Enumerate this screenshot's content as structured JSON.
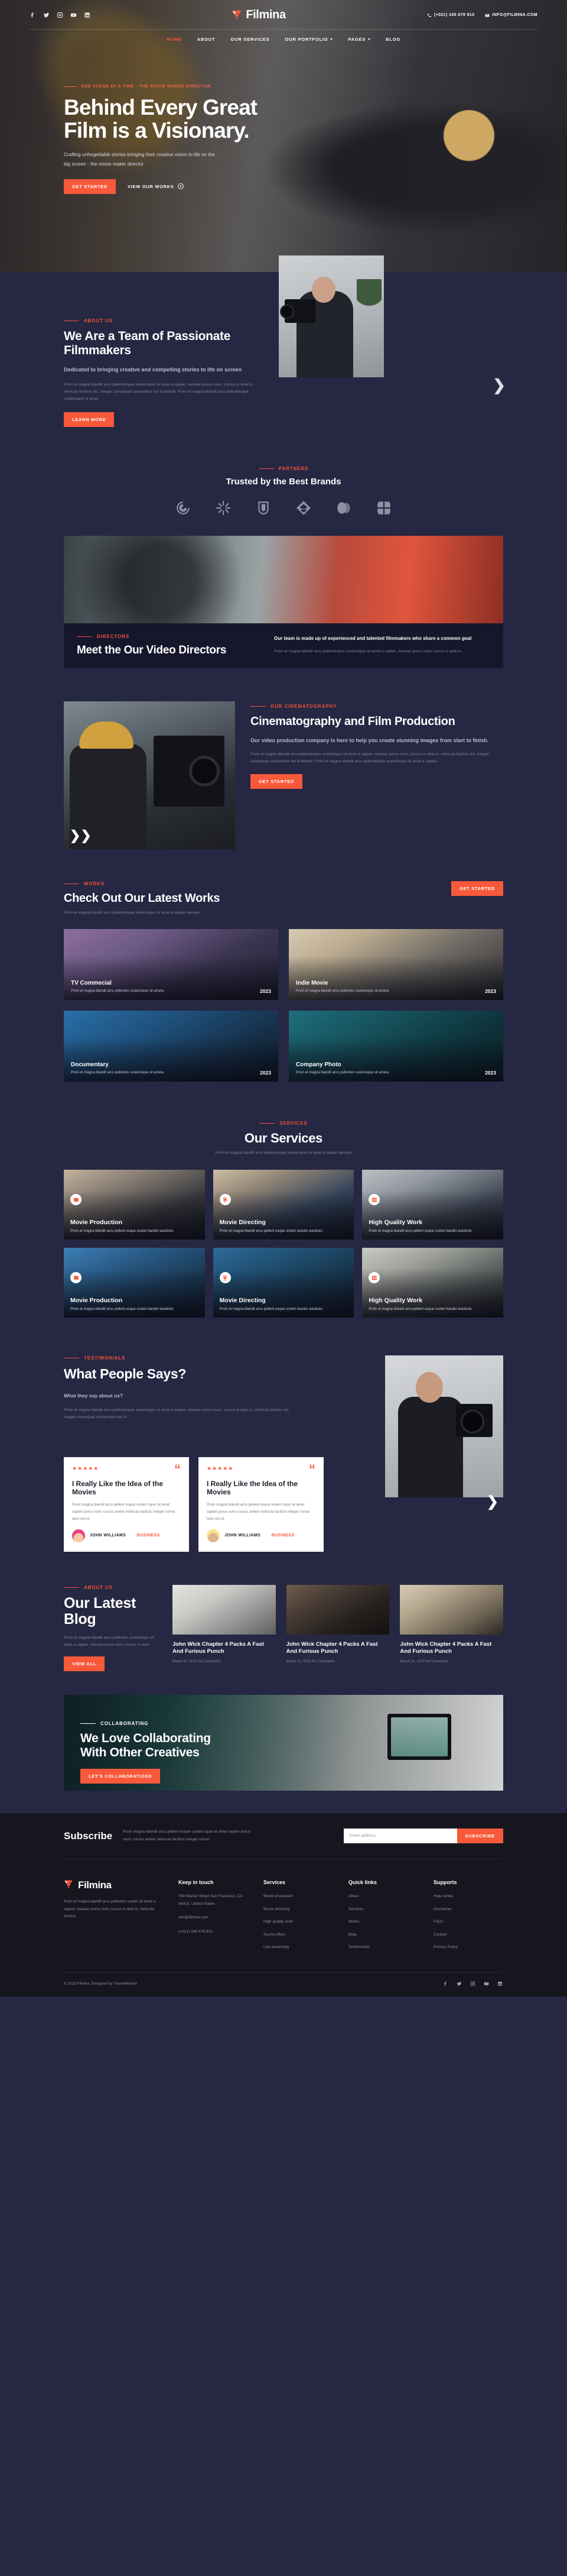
{
  "brand": {
    "name": "Filmina"
  },
  "topbar": {
    "socials": [
      "facebook-icon",
      "twitter-icon",
      "instagram-icon",
      "youtube-icon",
      "linkedin-icon"
    ],
    "phone": "(+021) 345 678 910",
    "email": "INFO@FILMINA.COM"
  },
  "nav": {
    "items": [
      {
        "label": "HOME",
        "active": true,
        "caret": false
      },
      {
        "label": "ABOUT",
        "active": false,
        "caret": false
      },
      {
        "label": "OUR SERVICES",
        "active": false,
        "caret": false
      },
      {
        "label": "OUR PORTFOLIO",
        "active": false,
        "caret": true
      },
      {
        "label": "PAGES",
        "active": false,
        "caret": true
      },
      {
        "label": "BLOG",
        "active": false,
        "caret": false
      }
    ]
  },
  "hero": {
    "eyebrow": "ONE SCENE AT A TIME - THE MOVIE MAKER DIRECTOR.",
    "title_line1": "Behind Every Great",
    "title_line2": "Film is a Visionary.",
    "subtitle": "Crafting unforgettable stories bringing their creative vision to life on the big screen - the movie maker director",
    "primary_cta": "GET STARTED",
    "secondary_cta": "VIEW OUR WORKS"
  },
  "about": {
    "eyebrow": "ABOUT US",
    "title": "We Are a Team of Passionate Filmmakers",
    "lead": "Dedicated to bringing creative and compelling stories to life on screen",
    "body": "Proin et magna blandit arcu pellentesque scelerisque sit amet a sapien. Aenean purus nunc, cursus in ante in, vehicula facilisis dui. Integer consequat consectetur est id blandit. Proin et magna blandit arcu pellentesque scelerisque sit amet.",
    "cta": "LEARN MORE"
  },
  "partners": {
    "eyebrow": "PARTNERS",
    "title": "Trusted by the Best Brands",
    "logos": [
      "loop-logo",
      "burst-logo",
      "arch-logo",
      "chevron-diamond-logo",
      "двойной-oval-logo",
      "quad-logo"
    ]
  },
  "directors": {
    "eyebrow": "DIRECTORS",
    "title": "Meet the Our Video Directors",
    "lead": "Our team is made up of experienced and talented filmmakers who share a common goal",
    "body": "Proin et magna blandit arcu pellentesque scelerisque sit amet a sapien. Aenean purus nunc cursus in ante in."
  },
  "cinematography": {
    "eyebrow": "OUR CINEMATOGRAPHY",
    "title": "Cinematography and Film Production",
    "lead": "Our video production company is here to help you create stunning images from start to finish.",
    "body": "Proin et magna blandit arcu pellentesque scelerisque sit amet a sapien. Aenean purus nunc, cursus in ante in, vehicula facilisis dui. Integer consequat consectetur est id blandit. Proin et magna blandit arcu pellentesque scelerisque sit amet a sapien.",
    "cta": "GET STARTED"
  },
  "works": {
    "eyebrow": "WORKS",
    "title": "Check Out Our Latest Works",
    "subtitle": "Proin et magna blandit arcu pellentesque scelerisque sit amet a sapien aenean",
    "cta": "GET STARTED",
    "items": [
      {
        "title": "TV Commecial",
        "desc": "Proin et magna blandit arcu pellentes scelerisque sit ameta.",
        "year": "2023"
      },
      {
        "title": "Indie Movie",
        "desc": "Proin et magna blandit arcu pellentes scelerisque sit ameta.",
        "year": "2023"
      },
      {
        "title": "Documentary",
        "desc": "Proin et magna blandit arcu pellentes scelerisque sit ameta.",
        "year": "2023"
      },
      {
        "title": "Company Photo",
        "desc": "Proin et magna blandit arcu pellentes scelerisque sit ameta.",
        "year": "2023"
      }
    ]
  },
  "services": {
    "eyebrow": "SERVICES",
    "title": "Our Services",
    "subtitle": "Proin et magna blandit arcu pellentesque scelerisque sit amet a sapien aenean",
    "items": [
      {
        "title": "Movie Production",
        "desc": "Proin et magna blandit arcu pellent esque sceleri bandio wasikolo.",
        "icon": "clapper-icon"
      },
      {
        "title": "Movie Directing",
        "desc": "Proin et magna blandit arcu pellent esque sceleri bandio wasikolo.",
        "icon": "director-chair-icon"
      },
      {
        "title": "High Quality Work",
        "desc": "Proin et magna blandit arcu pellent esque sceleri bandio wasikolo.",
        "icon": "hd-icon"
      },
      {
        "title": "Movie Production",
        "desc": "Proin et magna blandit arcu pellent esque sceleri bandio wasikolo.",
        "icon": "clapper-icon"
      },
      {
        "title": "Movie Directing",
        "desc": "Proin et magna blandit arcu pellent esque sceleri bandio wasikolo.",
        "icon": "director-chair-icon"
      },
      {
        "title": "High Quality Work",
        "desc": "Proin et magna blandit arcu pellent esque sceleri bandio wasikolo.",
        "icon": "hd-icon"
      }
    ]
  },
  "testimonials": {
    "eyebrow": "TESTIMONIALS",
    "title": "What People Says?",
    "lead": "What they say about us?",
    "body": "Proin et magna blandit arcu pellentesque scelerisque sit amet a sapien. Aenean purus nunc, cursus in ante in, vehicula facilisis dui. Integer consequat consectetur est id.",
    "items": [
      {
        "stars": "★★★★★",
        "title": "I Really Like the Idea of the Movies",
        "text": "Proin magna blandit arcu pellent esque sceleri sque sit amet sapien purus nunc cursus antein vehicula facilisis Integer conse tetur est id.",
        "name": "JOHN WILLIAMS",
        "role": "BUSINESS"
      },
      {
        "stars": "★★★★★",
        "title": "I Really Like the Idea of the Movies",
        "text": "Proin magna blandit arcu pellent esque sceleri sque sit amet sapien purus nunc cursus antein vehicula facilisis Integer conse tetur est id.",
        "name": "JOHN WILLIAMS",
        "role": "BUSINESS"
      }
    ]
  },
  "blog": {
    "eyebrow": "ABOUT US",
    "title": "Our Latest Blog",
    "body": "Proin et magna blandit arcu pellentes scelerisque sit amet a sapien. Aenean purus nunc cursus in ante",
    "cta": "VIEW ALL",
    "posts": [
      {
        "title": "John Wick Chapter 4 Packs A Fast And Furious Punch",
        "meta": "March 31, 2023 No Comments"
      },
      {
        "title": "John Wick Chapter 4 Packs A Fast And Furious Punch",
        "meta": "March 31, 2023 No Comments"
      },
      {
        "title": "John Wick Chapter 4 Packs A Fast And Furious Punch",
        "meta": "March 31, 2023 No Comments"
      }
    ]
  },
  "collaborate": {
    "eyebrow": "COLLABORATING",
    "title_line1": "We Love Collaborating",
    "title_line2": "With Other Creatives",
    "cta": "LET'S COLLABORATIONS"
  },
  "subscribe": {
    "title": "Subscribe",
    "desc": "Proin magna blandit arcu pellent esque sceleri sque sit amet sapien purus nunc cursus antein vehicula facilisis Integer conse",
    "placeholder": "Email address",
    "button": "SUBSCRIBE"
  },
  "footer": {
    "about": "Proin et magna blandit arcu pellentes sceleri sit amet a sapien. Aenean purus nunc cursus in ante in, vehicula facilisis",
    "columns": [
      {
        "heading": "Keep in touch",
        "items": [
          "768 Market Street San Francisco, CA 64015, United States",
          "info@filmina.com",
          "(+021) 345 678 910"
        ]
      },
      {
        "heading": "Services",
        "items": [
          "Movie production",
          "Movie directing",
          "High quality work",
          "Sound effect",
          "Live streaming"
        ]
      },
      {
        "heading": "Quick links",
        "items": [
          "About",
          "Services",
          "Works",
          "Blog",
          "Testimonials"
        ]
      },
      {
        "heading": "Supports",
        "items": [
          "Help center",
          "Disclaimer",
          "FAQs",
          "Contact",
          "Privacy Policy"
        ]
      }
    ],
    "copyright": "© 2023 Filmina. Designed by ThemeWarrior",
    "socials": [
      "facebook-icon",
      "twitter-icon",
      "instagram-icon",
      "youtube-icon",
      "linkedin-icon"
    ]
  },
  "colors": {
    "accent": "#f8593a",
    "bg": "#262742",
    "dark": "#16161f",
    "card": "#16172b"
  }
}
